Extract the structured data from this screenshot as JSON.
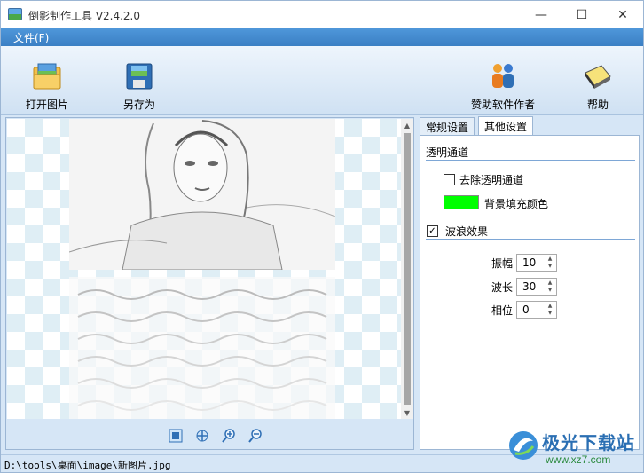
{
  "window": {
    "title": "倒影制作工具 V2.4.2.0",
    "min_glyph": "—",
    "max_glyph": "☐",
    "close_glyph": "✕"
  },
  "menu": {
    "file": "文件(F)"
  },
  "toolbar": {
    "open_label": "打开图片",
    "saveas_label": "另存为",
    "sponsor_label": "赞助软件作者",
    "help_label": "帮助"
  },
  "preview": {
    "up_arrow": "▲",
    "down_arrow": "▼"
  },
  "tabs": {
    "general": "常规设置",
    "other": "其他设置"
  },
  "settings": {
    "transparency_group": "透明通道",
    "remove_alpha_label": "去除透明通道",
    "remove_alpha_checked": false,
    "fill_color_label": "背景填充颜色",
    "fill_color": "#00ff00",
    "wave_label": "波浪效果",
    "wave_checked": true,
    "wave_check_glyph": "✓",
    "amplitude_label": "振幅",
    "amplitude_value": "10",
    "wavelength_label": "波长",
    "wavelength_value": "30",
    "phase_label": "相位",
    "phase_value": "0"
  },
  "status": {
    "path": "D:\\tools\\桌面\\image\\新图片.jpg"
  },
  "watermark": {
    "brand": "极光下载站",
    "url": "www.xz7.com"
  },
  "colors": {
    "menubar": "#3b7fc4",
    "accent": "#2b6fb3",
    "swatch": "#00ff00"
  }
}
